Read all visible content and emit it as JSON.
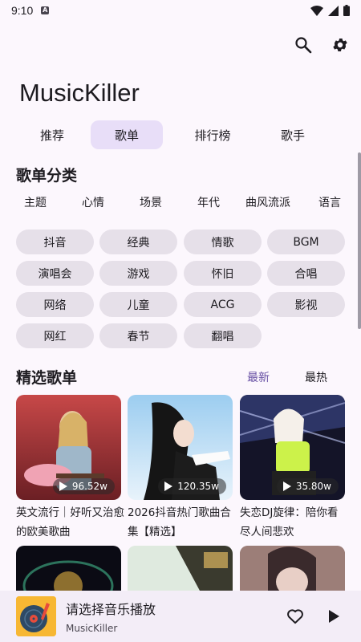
{
  "status": {
    "time": "9:10",
    "a_badge": "A"
  },
  "app": {
    "title": "MusicKiller"
  },
  "tabs": [
    {
      "label": "推荐"
    },
    {
      "label": "歌单"
    },
    {
      "label": "排行榜"
    },
    {
      "label": "歌手"
    }
  ],
  "active_tab": "歌单",
  "categories": {
    "title": "歌单分类",
    "tabs": [
      "主题",
      "心情",
      "场景",
      "年代",
      "曲风流派",
      "语言"
    ],
    "chips": [
      "抖音",
      "经典",
      "情歌",
      "BGM",
      "演唱会",
      "游戏",
      "怀旧",
      "合唱",
      "网络",
      "儿童",
      "ACG",
      "影视",
      "网红",
      "春节",
      "翻唱"
    ]
  },
  "featured": {
    "title": "精选歌单",
    "filters": {
      "latest": "最新",
      "hottest": "最热"
    },
    "active_filter": "最新",
    "accent_color": "#6750a4",
    "cards": [
      {
        "title": "英文流行｜好听又治愈的欧美歌曲",
        "plays": "96.52w"
      },
      {
        "title": "2026抖音热门歌曲合集【精选】",
        "plays": "120.35w"
      },
      {
        "title": "失恋DJ旋律：陪你看尽人间悲欢",
        "plays": "35.80w"
      }
    ]
  },
  "player": {
    "title": "请选择音乐播放",
    "subtitle": "MusicKiller"
  },
  "icons": {
    "search": "search-icon",
    "settings": "gear-icon",
    "favorite": "heart-icon",
    "play": "play-icon"
  }
}
